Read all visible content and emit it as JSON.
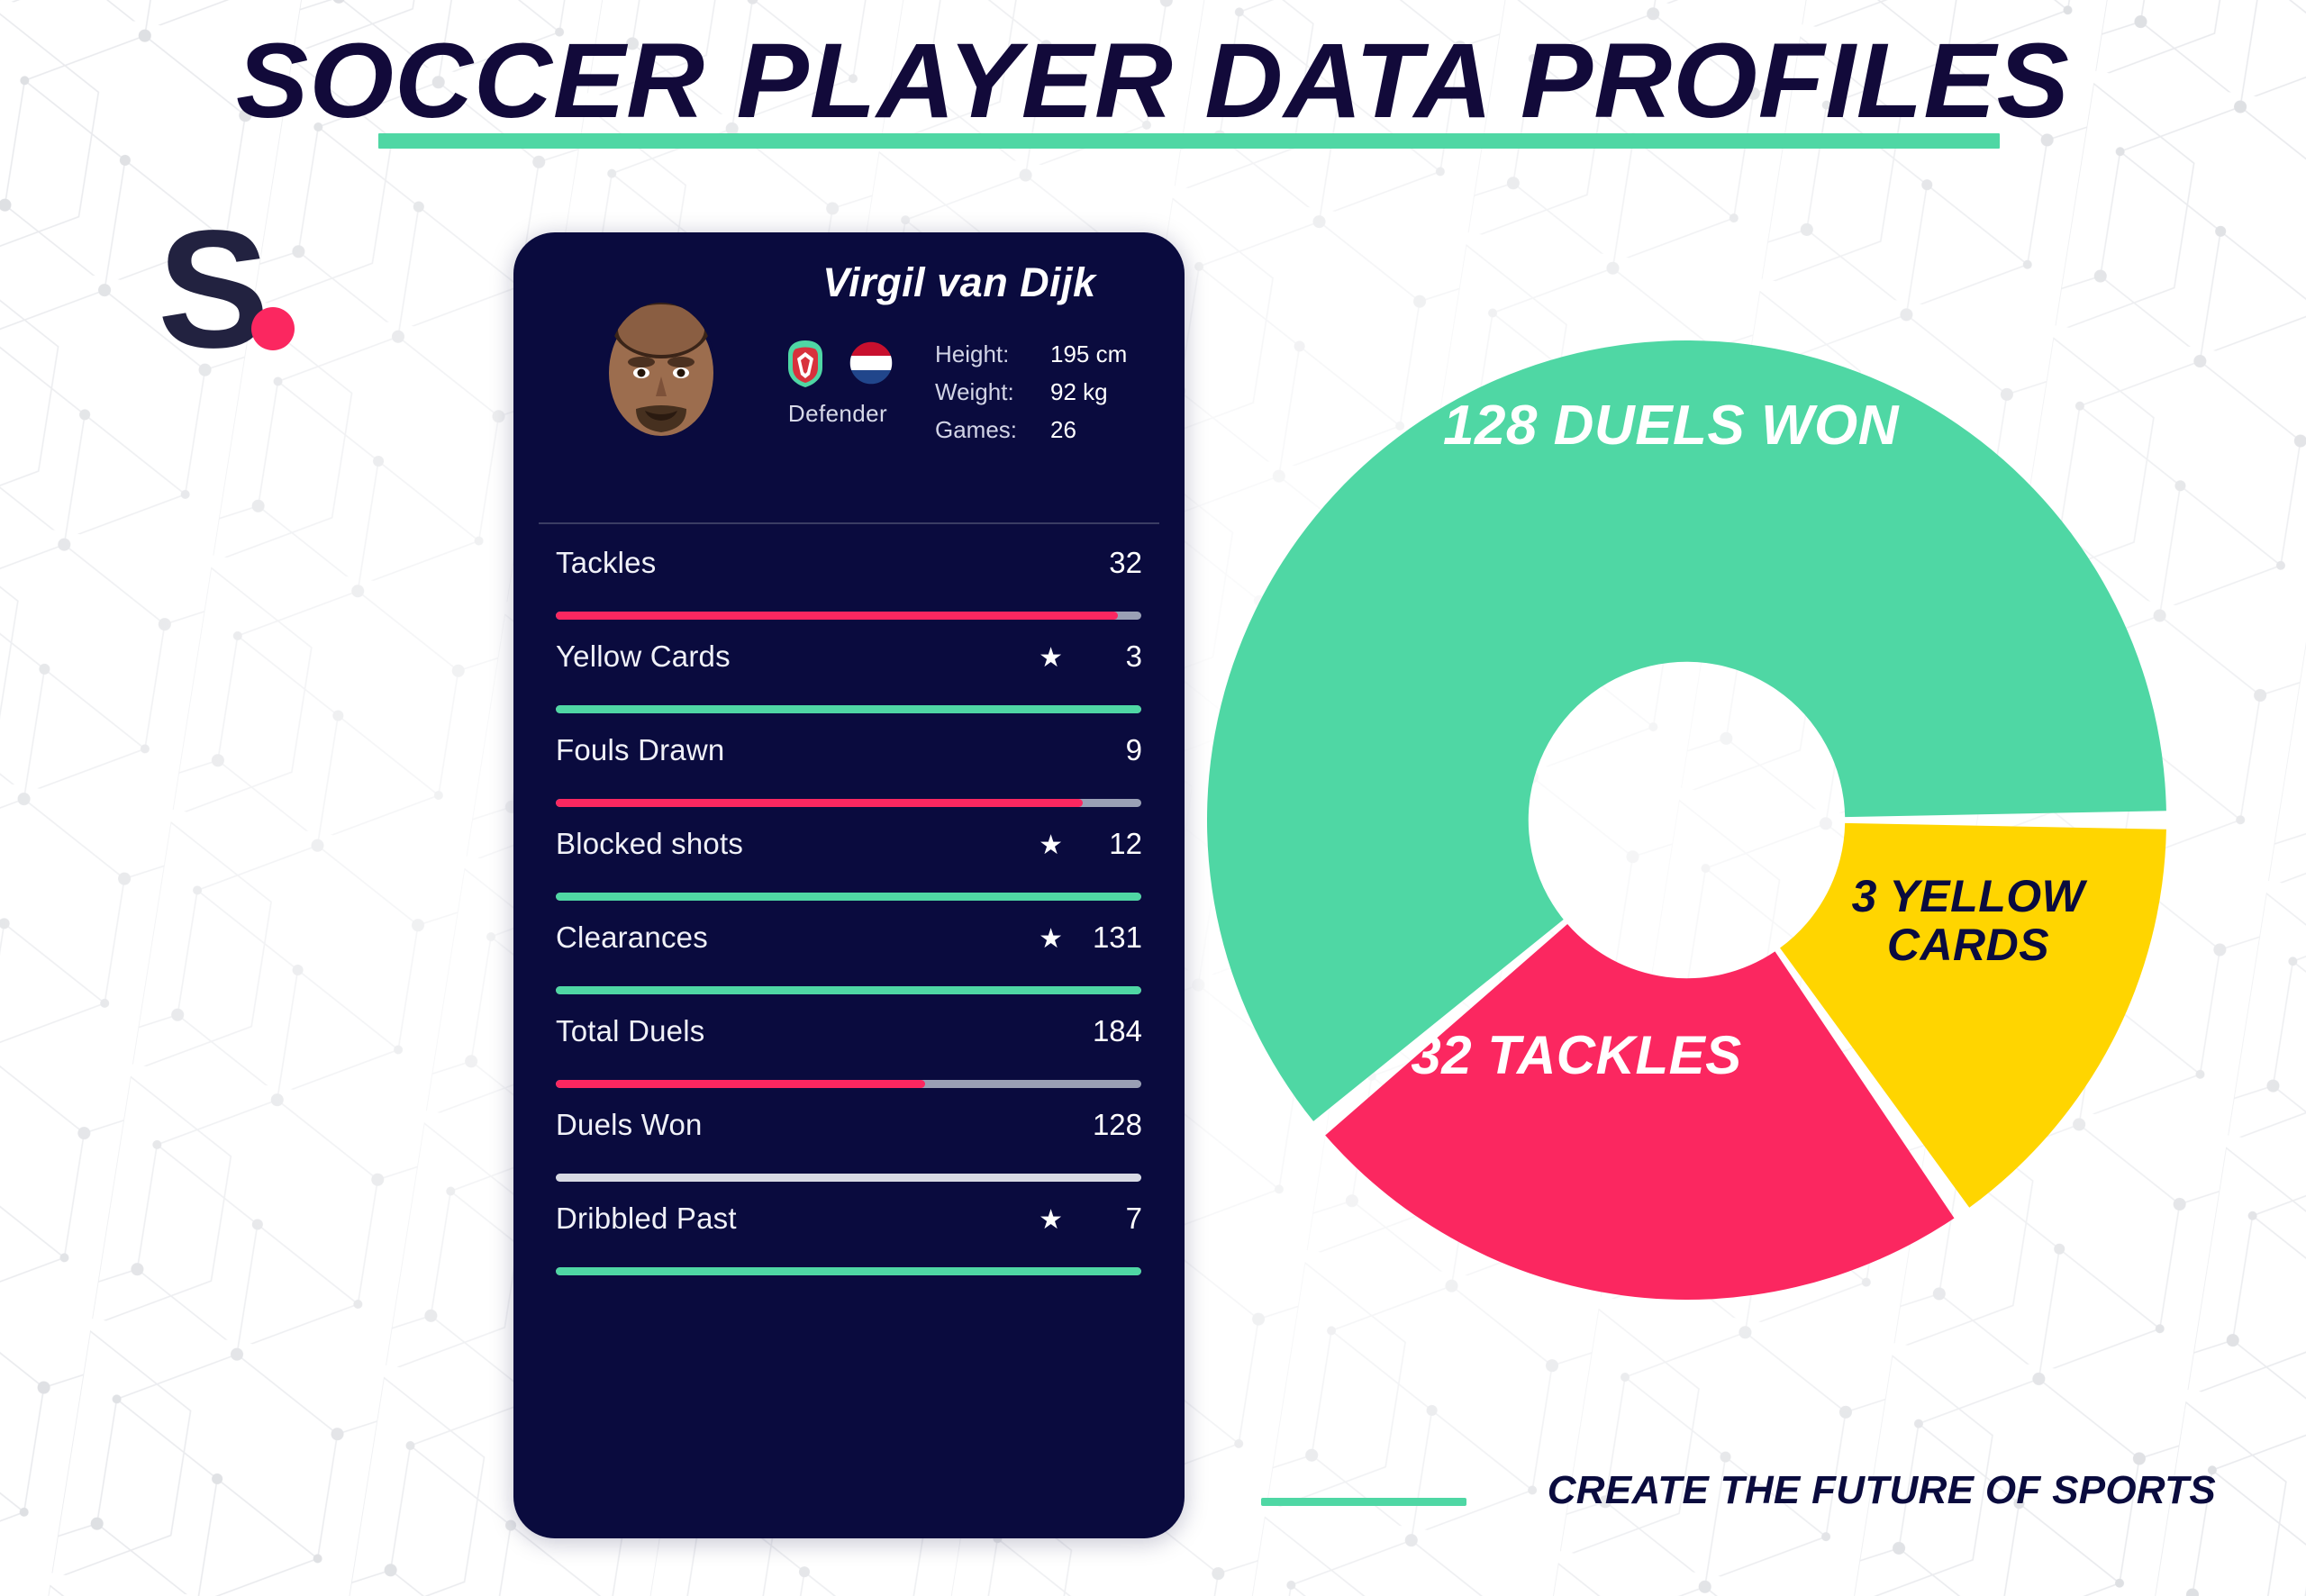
{
  "header": {
    "title": "SOCCER PLAYER DATA PROFILES",
    "underline_color": "#4FD7A4"
  },
  "logo": {
    "letter": "S",
    "dot_color": "#FB2760",
    "letter_color": "#222240"
  },
  "card": {
    "player_name": "Virgil van Dijk",
    "position": "Defender",
    "club_icon": "liverpool-crest-icon",
    "country_icon": "netherlands-flag-icon",
    "avatar_icon": "player-portrait",
    "attributes": [
      {
        "key": "Height:",
        "value": "195 cm"
      },
      {
        "key": "Weight:",
        "value": "92 kg"
      },
      {
        "key": "Games:",
        "value": "26"
      }
    ],
    "stats": [
      {
        "label": "Tackles",
        "value": "32",
        "star": false,
        "fill_pct": 96,
        "fill_color": "#FB2760"
      },
      {
        "label": "Yellow Cards",
        "value": "3",
        "star": true,
        "fill_pct": 100,
        "fill_color": "#4FD7A4"
      },
      {
        "label": "Fouls Drawn",
        "value": "9",
        "star": false,
        "fill_pct": 90,
        "fill_color": "#FB2760"
      },
      {
        "label": "Blocked shots",
        "value": "12",
        "star": true,
        "fill_pct": 100,
        "fill_color": "#4FD7A4"
      },
      {
        "label": "Clearances",
        "value": "131",
        "star": true,
        "fill_pct": 100,
        "fill_color": "#4FD7A4"
      },
      {
        "label": "Total Duels",
        "value": "184",
        "star": false,
        "fill_pct": 63,
        "fill_color": "#FB2760"
      },
      {
        "label": "Duels Won",
        "value": "128",
        "star": false,
        "fill_pct": 100,
        "fill_color": "#D8DAE4"
      },
      {
        "label": "Dribbled Past",
        "value": "7",
        "star": true,
        "fill_pct": 100,
        "fill_color": "#4FD7A4"
      }
    ]
  },
  "chart_data": {
    "type": "pie",
    "title": "",
    "donut": true,
    "inner_radius_ratio": 0.33,
    "legend": "in-slice",
    "categories": [
      "Duels Won",
      "Tackles",
      "Yellow Cards"
    ],
    "values": [
      128,
      32,
      3
    ],
    "labels": [
      "128 DUELS WON",
      "32 TACKLES",
      "3 YELLOW CARDS"
    ],
    "colors": [
      "#4FD7A4",
      "#FB2760",
      "#FFD500"
    ],
    "label_colors": [
      "#FFFFFF",
      "#FFFFFF",
      "#0A0B3E"
    ],
    "slice_angles_deg": [
      220,
      85,
      55
    ],
    "start_angle_deg": 0
  },
  "footer": {
    "tagline": "CREATE THE FUTURE OF SPORTS",
    "rule_color": "#4FD7A4"
  }
}
